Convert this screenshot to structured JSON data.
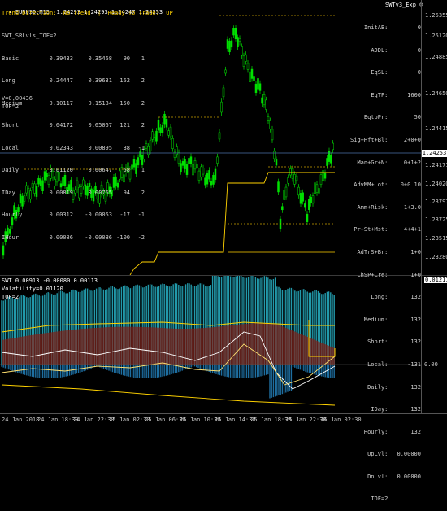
{
  "header": {
    "title": "EURUSD,M15  1.24293 1.24293 1.24247 1.24253",
    "status": "Trend Direction:  No Trend  |  Ready To Trade:  UP"
  },
  "stats": {
    "title": "SWT_SRLvls_TOF=2",
    "rows": [
      [
        "Basic",
        "0.39433",
        "0.35468",
        "90",
        "1"
      ],
      [
        "Long",
        "0.24447",
        "0.39631",
        "162",
        "2"
      ],
      [
        "Medium",
        "0.10117",
        "0.15184",
        "150",
        "2"
      ],
      [
        "Short",
        "0.04172",
        "0.05067",
        "121",
        "2"
      ],
      [
        "Local",
        "0.02343",
        "0.00895",
        "38",
        "-1"
      ],
      [
        "Daily",
        "0.01120",
        "0.00647",
        "58",
        "1"
      ],
      [
        "IDay",
        "0.00819",
        "0.00765",
        "94",
        "2"
      ],
      [
        "Hourly",
        "0.00312",
        "-0.00053",
        "-17",
        "-1"
      ],
      [
        "IHour",
        "0.00086",
        "-0.00086",
        "-100",
        "-2"
      ]
    ],
    "v_line": "V=0.00436",
    "tof": "TOF=2"
  },
  "panel": {
    "title": "SWTv3_Exp",
    "rows": [
      [
        "InitAB:",
        "0"
      ],
      [
        "ADDL:",
        "0"
      ],
      [
        "EqSL:",
        "0"
      ],
      [
        "EqTP:",
        "1600"
      ],
      [
        "EqtpPr:",
        "50"
      ],
      [
        "Sig+Hft+Bl:",
        "2+0+0"
      ],
      [
        "Man+Gr+N:",
        "0+1+2"
      ],
      [
        "AdvMM+Lot:",
        "0+0.10"
      ],
      [
        "Amm+Risk:",
        "1+3.0"
      ],
      [
        "Pr+St+Mst:",
        "4+4+1"
      ],
      [
        "AdTrS+Br:",
        "1+0"
      ],
      [
        "ChSP+Lre:",
        "1+0"
      ],
      [
        "Long:",
        "132"
      ],
      [
        "Medium:",
        "132"
      ],
      [
        "Short:",
        "132"
      ],
      [
        "Local:",
        "-131"
      ],
      [
        "Daily:",
        "132"
      ],
      [
        "IDay:",
        "132"
      ],
      [
        "Hourly:",
        "132"
      ],
      [
        "UpLvl:",
        "0.00000"
      ],
      [
        "DnLvl:",
        "0.00000"
      ],
      [
        "TOF=2",
        ""
      ]
    ]
  },
  "price_axis": {
    "labels": [
      "1.25355",
      "1.25120",
      "1.24885",
      "1.24650",
      "1.24415",
      "1.24171",
      "1.24020",
      "1.23797",
      "1.23725",
      "1.23515",
      "1.23280"
    ],
    "current": "1.24253"
  },
  "sub_window": {
    "label1": "SWT 0.00913 -0.00080 0.00113",
    "label2": "Volatility=0.01120",
    "label3": "TOF=2",
    "max_label": "0.01211",
    "zero_label": "0.00"
  },
  "time_axis": {
    "labels": [
      "24 Jan 2018",
      "24 Jan 18:30",
      "24 Jan 22:30",
      "25 Jan 02:30",
      "25 Jan 06:30",
      "25 Jan 10:30",
      "25 Jan 14:30",
      "25 Jan 18:30",
      "25 Jan 22:30",
      "26 Jan 02:30"
    ]
  },
  "colors": {
    "candle_bull": "#00e000",
    "candle_bear": "#00a000",
    "level_line": "#ffd200",
    "level_dash": "#c8a000",
    "price_line": "#4a6fa8",
    "hist_blue": "#1e6ea0",
    "hist_red": "#8a1a10",
    "hist_cyan": "#28b4c8"
  }
}
